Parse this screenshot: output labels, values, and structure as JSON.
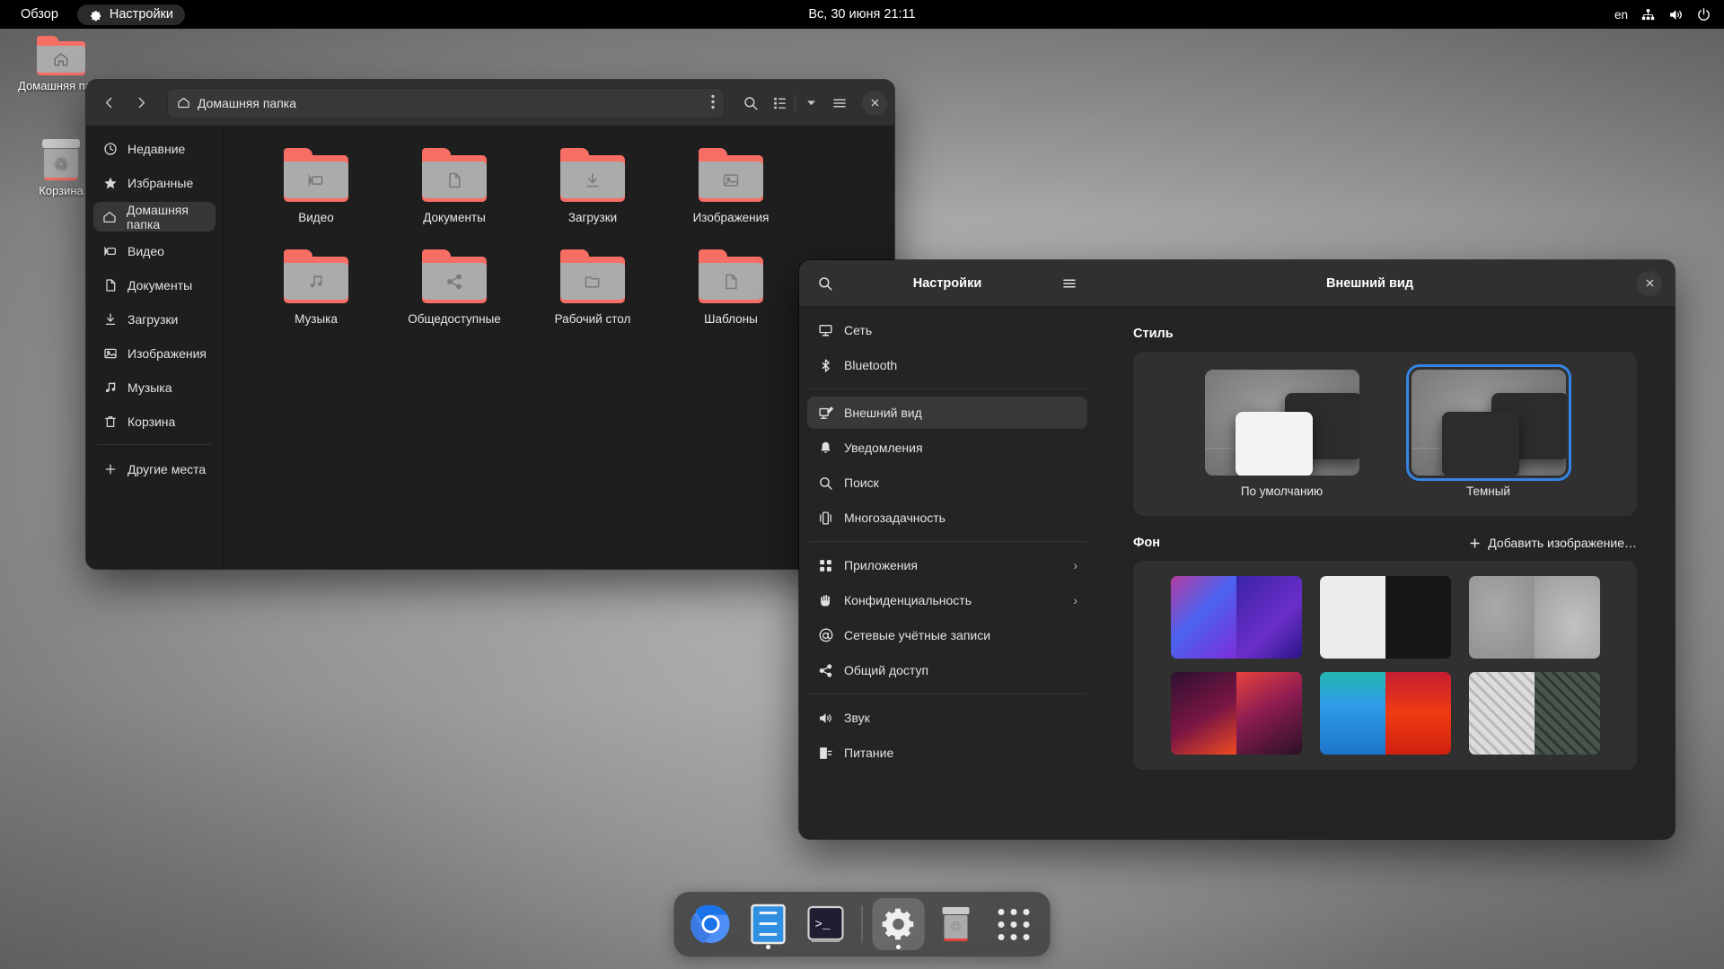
{
  "topbar": {
    "overview_label": "Обзор",
    "app_label": "Настройки",
    "app_icon": "gear-icon",
    "clock": "Вс, 30 июня  21:11",
    "language": "en",
    "indicators": [
      "network-wired-icon",
      "volume-icon",
      "power-icon"
    ]
  },
  "desktop_icons": [
    {
      "label": "Домашняя папка",
      "icon": "home-folder-icon"
    },
    {
      "label": "Корзина",
      "icon": "trash-icon"
    }
  ],
  "files_window": {
    "path_label": "Домашняя папка",
    "path_icon": "home-icon",
    "back_icon": "chevron-left-icon",
    "forward_icon": "chevron-right-icon",
    "menu_dots_icon": "vertical-dots-icon",
    "search_icon": "search-icon",
    "view_list_icon": "list-view-icon",
    "view_dropdown_icon": "chevron-down-icon",
    "hamburger_icon": "hamburger-menu-icon",
    "close_icon": "close-icon",
    "sidebar": [
      {
        "label": "Недавние",
        "icon": "clock-icon",
        "selected": false
      },
      {
        "label": "Избранные",
        "icon": "star-icon",
        "selected": false
      },
      {
        "label": "Домашняя папка",
        "icon": "home-icon",
        "selected": true
      },
      {
        "label": "Видео",
        "icon": "video-icon",
        "selected": false
      },
      {
        "label": "Документы",
        "icon": "document-icon",
        "selected": false
      },
      {
        "label": "Загрузки",
        "icon": "download-icon",
        "selected": false
      },
      {
        "label": "Изображения",
        "icon": "image-icon",
        "selected": false
      },
      {
        "label": "Музыка",
        "icon": "music-icon",
        "selected": false
      },
      {
        "label": "Корзина",
        "icon": "trash-icon",
        "selected": false
      }
    ],
    "other_places": {
      "label": "Другие места",
      "icon": "plus-icon"
    },
    "folders": [
      {
        "label": "Видео",
        "icon": "video-icon"
      },
      {
        "label": "Документы",
        "icon": "document-icon"
      },
      {
        "label": "Загрузки",
        "icon": "download-icon"
      },
      {
        "label": "Изображения",
        "icon": "image-icon"
      },
      {
        "label": "Музыка",
        "icon": "music-icon"
      },
      {
        "label": "Общедоступные",
        "icon": "share-icon"
      },
      {
        "label": "Рабочий стол",
        "icon": "folder-icon"
      },
      {
        "label": "Шаблоны",
        "icon": "template-icon"
      }
    ]
  },
  "settings_window": {
    "title": "Настройки",
    "search_icon": "search-icon",
    "hamburger_icon": "hamburger-menu-icon",
    "panel_title": "Внешний вид",
    "close_icon": "close-icon",
    "nav": [
      {
        "label": "Сеть",
        "icon": "network-icon",
        "selected": false,
        "chevron": false
      },
      {
        "label": "Bluetooth",
        "icon": "bluetooth-icon",
        "selected": false,
        "chevron": false
      },
      {
        "divider": true
      },
      {
        "label": "Внешний вид",
        "icon": "appearance-icon",
        "selected": true,
        "chevron": false
      },
      {
        "label": "Уведомления",
        "icon": "bell-icon",
        "selected": false,
        "chevron": false
      },
      {
        "label": "Поиск",
        "icon": "search-icon",
        "selected": false,
        "chevron": false
      },
      {
        "label": "Многозадачность",
        "icon": "multitasking-icon",
        "selected": false,
        "chevron": false
      },
      {
        "divider": true
      },
      {
        "label": "Приложения",
        "icon": "apps-grid-icon",
        "selected": false,
        "chevron": true
      },
      {
        "label": "Конфиденциальность",
        "icon": "hand-icon",
        "selected": false,
        "chevron": true
      },
      {
        "label": "Сетевые учётные записи",
        "icon": "at-sign-icon",
        "selected": false,
        "chevron": false
      },
      {
        "label": "Общий доступ",
        "icon": "share-icon",
        "selected": false,
        "chevron": false
      },
      {
        "divider": true
      },
      {
        "label": "Звук",
        "icon": "sound-icon",
        "selected": false,
        "chevron": false
      },
      {
        "label": "Питание",
        "icon": "power-plug-icon",
        "selected": false,
        "chevron": false
      }
    ],
    "style_section": {
      "title": "Стиль",
      "options": [
        {
          "label": "По умолчанию",
          "selected": false
        },
        {
          "label": "Темный",
          "selected": true
        }
      ],
      "selection_color": "#3584e4"
    },
    "background_section": {
      "title": "Фон",
      "add_label": "Добавить изображение…",
      "add_icon": "plus-icon",
      "thumbnails": [
        {
          "name": "wallpaper-geometric-violet",
          "left": "#c0399a",
          "right": "#3b1f9e"
        },
        {
          "name": "wallpaper-paper-light-dark",
          "left": "#ececec",
          "right": "#161616"
        },
        {
          "name": "wallpaper-cube-grey",
          "left": "#9a9a9a",
          "right": "#b5b5b5"
        },
        {
          "name": "wallpaper-waves-magenta",
          "left": "#e8413c",
          "right": "#2a1128"
        },
        {
          "name": "wallpaper-drip-blue-orange",
          "left": "#2e9ce8",
          "right": "#ef3b11"
        },
        {
          "name": "wallpaper-keycaps",
          "left": "#d4d4d4",
          "right": "#3b463f"
        }
      ]
    }
  },
  "dock": {
    "items": [
      {
        "name": "chromium",
        "icon": "chromium-icon",
        "running": false,
        "active": false
      },
      {
        "name": "files",
        "icon": "file-cabinet-icon",
        "running": true,
        "active": false
      },
      {
        "name": "terminal",
        "icon": "terminal-icon",
        "running": false,
        "active": false
      },
      {
        "name": "settings",
        "icon": "gear-icon",
        "running": true,
        "active": true
      },
      {
        "name": "trash",
        "icon": "trash-icon",
        "running": false,
        "active": false
      },
      {
        "name": "show-applications",
        "icon": "apps-grid-icon",
        "running": false,
        "active": false
      }
    ]
  }
}
